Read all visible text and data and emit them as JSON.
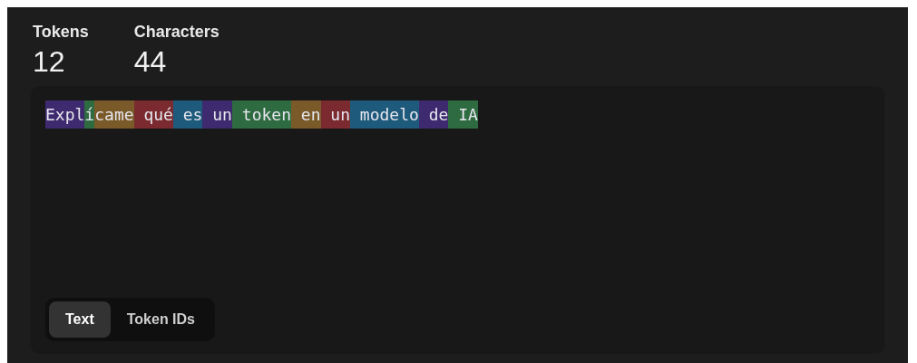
{
  "stats": [
    {
      "label": "Tokens",
      "value": "12"
    },
    {
      "label": "Characters",
      "value": "44"
    }
  ],
  "tokens": [
    {
      "text": "Expl",
      "color": "#3e2a6e"
    },
    {
      "text": "í",
      "color": "#2e6b40"
    },
    {
      "text": "came",
      "color": "#7a5a28"
    },
    {
      "text": " qué",
      "color": "#7b2a30"
    },
    {
      "text": " es",
      "color": "#1e5a7c"
    },
    {
      "text": " un",
      "color": "#3e2a6e"
    },
    {
      "text": " token",
      "color": "#2e6b40"
    },
    {
      "text": " en",
      "color": "#7a5a28"
    },
    {
      "text": " un",
      "color": "#7b2a30"
    },
    {
      "text": " modelo",
      "color": "#1e5a7c"
    },
    {
      "text": " de",
      "color": "#3e2a6e"
    },
    {
      "text": " IA",
      "color": "#2e6b40"
    }
  ],
  "view_tabs": [
    {
      "label": "Text",
      "selected": true
    },
    {
      "label": "Token IDs",
      "selected": false
    }
  ]
}
